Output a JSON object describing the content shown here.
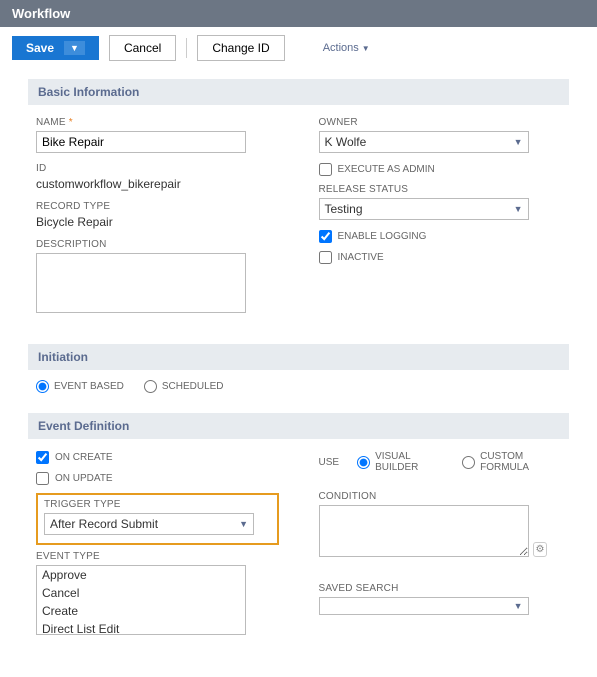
{
  "header": {
    "title": "Workflow"
  },
  "toolbar": {
    "save": "Save",
    "cancel": "Cancel",
    "changeId": "Change ID",
    "actions": "Actions"
  },
  "sections": {
    "basicInfo": "Basic Information",
    "initiation": "Initiation",
    "eventDef": "Event Definition"
  },
  "basic": {
    "left": {
      "nameLabel": "NAME",
      "nameValue": "Bike Repair",
      "idLabel": "ID",
      "idValue": "customworkflow_bikerepair",
      "recordTypeLabel": "RECORD TYPE",
      "recordTypeValue": "Bicycle Repair",
      "descriptionLabel": "DESCRIPTION"
    },
    "right": {
      "ownerLabel": "OWNER",
      "ownerValue": "K Wolfe",
      "execAsAdmin": "EXECUTE AS ADMIN",
      "releaseStatusLabel": "RELEASE STATUS",
      "releaseStatusValue": "Testing",
      "enableLogging": "ENABLE LOGGING",
      "inactive": "INACTIVE"
    }
  },
  "initiation": {
    "eventBased": "EVENT BASED",
    "scheduled": "SCHEDULED"
  },
  "eventDef": {
    "left": {
      "onCreate": "ON CREATE",
      "onUpdate": "ON UPDATE",
      "triggerTypeLabel": "TRIGGER TYPE",
      "triggerTypeValue": "After Record Submit",
      "eventTypeLabel": "EVENT TYPE",
      "eventOptions": [
        "Approve",
        "Cancel",
        "Create",
        "Direct List Edit"
      ]
    },
    "right": {
      "use": "USE",
      "visualBuilder": "VISUAL BUILDER",
      "customFormula": "CUSTOM FORMULA",
      "conditionLabel": "CONDITION",
      "savedSearchLabel": "SAVED SEARCH"
    }
  }
}
